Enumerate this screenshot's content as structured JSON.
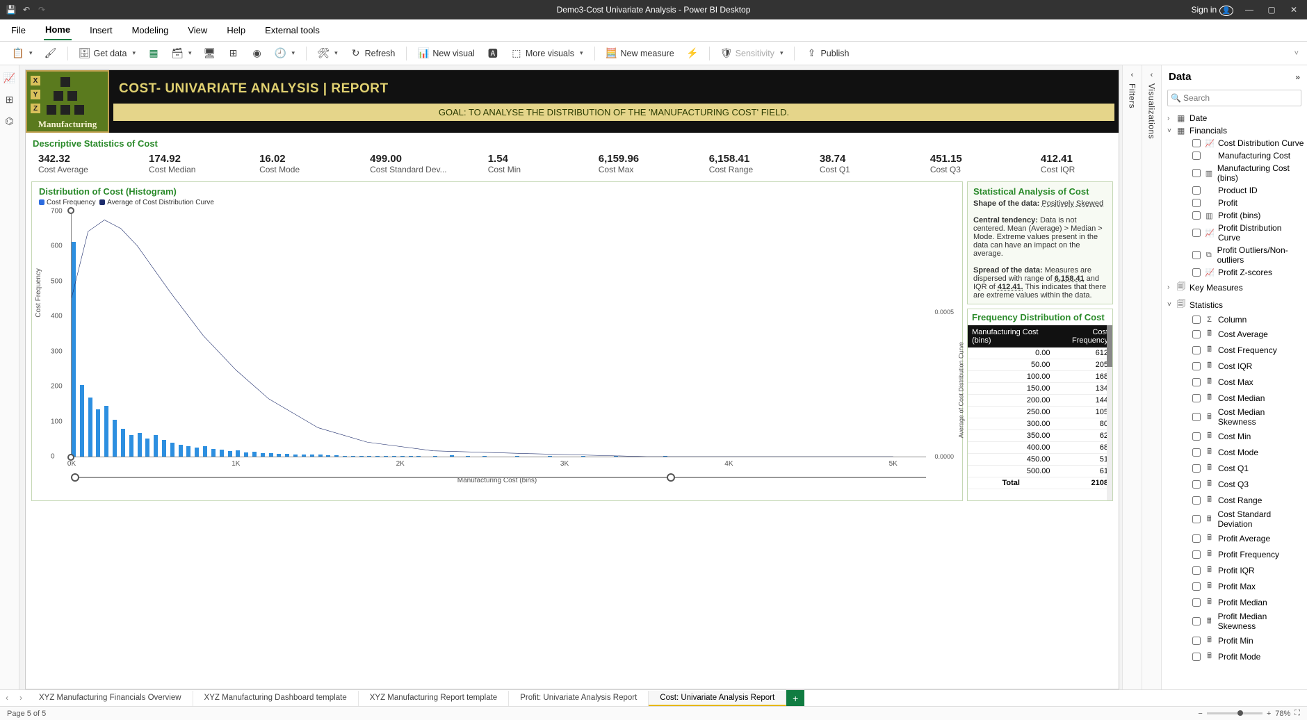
{
  "titlebar": {
    "title": "Demo3-Cost Univariate Analysis - Power BI Desktop",
    "sign_in": "Sign in"
  },
  "menubar": {
    "items": [
      "File",
      "Home",
      "Insert",
      "Modeling",
      "View",
      "Help",
      "External tools"
    ],
    "active": "Home"
  },
  "ribbon": {
    "get_data": "Get data",
    "refresh": "Refresh",
    "new_visual": "New visual",
    "more_visuals": "More visuals",
    "new_measure": "New measure",
    "sensitivity": "Sensitivity",
    "publish": "Publish"
  },
  "data_panel": {
    "header": "Data",
    "search_placeholder": "Search",
    "groups": [
      {
        "name": "Date",
        "expanded": false,
        "icon": "table"
      },
      {
        "name": "Financials",
        "expanded": true,
        "icon": "table",
        "fields": [
          {
            "name": "Cost Distribution Curve",
            "icon": "chart"
          },
          {
            "name": "Manufacturing Cost",
            "icon": ""
          },
          {
            "name": "Manufacturing Cost (bins)",
            "icon": "bins"
          },
          {
            "name": "Product ID",
            "icon": ""
          },
          {
            "name": "Profit",
            "icon": ""
          },
          {
            "name": "Profit (bins)",
            "icon": "bins"
          },
          {
            "name": "Profit Distribution Curve",
            "icon": "chart"
          },
          {
            "name": "Profit Outliers/Non-outliers",
            "icon": "group"
          },
          {
            "name": "Profit Z-scores",
            "icon": "chart"
          }
        ]
      },
      {
        "name": "Key Measures",
        "expanded": false,
        "icon": "measure"
      },
      {
        "name": "Statistics",
        "expanded": true,
        "icon": "measure",
        "fields": [
          {
            "name": "Column",
            "icon": "sigma"
          },
          {
            "name": "Cost Average",
            "icon": "calc"
          },
          {
            "name": "Cost Frequency",
            "icon": "calc"
          },
          {
            "name": "Cost IQR",
            "icon": "calc"
          },
          {
            "name": "Cost Max",
            "icon": "calc"
          },
          {
            "name": "Cost Median",
            "icon": "calc"
          },
          {
            "name": "Cost Median Skewness",
            "icon": "calc"
          },
          {
            "name": "Cost Min",
            "icon": "calc"
          },
          {
            "name": "Cost Mode",
            "icon": "calc"
          },
          {
            "name": "Cost Q1",
            "icon": "calc"
          },
          {
            "name": "Cost Q3",
            "icon": "calc"
          },
          {
            "name": "Cost Range",
            "icon": "calc"
          },
          {
            "name": "Cost Standard Deviation",
            "icon": "calc"
          },
          {
            "name": "Profit Average",
            "icon": "calc"
          },
          {
            "name": "Profit Frequency",
            "icon": "calc"
          },
          {
            "name": "Profit IQR",
            "icon": "calc"
          },
          {
            "name": "Profit Max",
            "icon": "calc"
          },
          {
            "name": "Profit Median",
            "icon": "calc"
          },
          {
            "name": "Profit Median Skewness",
            "icon": "calc"
          },
          {
            "name": "Profit Min",
            "icon": "calc"
          },
          {
            "name": "Profit Mode",
            "icon": "calc"
          }
        ]
      }
    ]
  },
  "side_panels": {
    "filters": "Filters",
    "visualizations": "Visualizations"
  },
  "report": {
    "logo_text": "Manufacturing",
    "xyz": [
      "X",
      "Y",
      "Z"
    ],
    "title": "COST- UNIVARIATE ANALYSIS | REPORT",
    "goal": "GOAL: TO ANALYSE THE DISTRIBUTION OF THE 'MANUFACTURING COST' FIELD.",
    "stats_title": "Descriptive Statistics of Cost",
    "stats": [
      {
        "val": "342.32",
        "lbl": "Cost Average"
      },
      {
        "val": "174.92",
        "lbl": "Cost Median"
      },
      {
        "val": "16.02",
        "lbl": "Cost Mode"
      },
      {
        "val": "499.00",
        "lbl": "Cost Standard Dev..."
      },
      {
        "val": "1.54",
        "lbl": "Cost Min"
      },
      {
        "val": "6,159.96",
        "lbl": "Cost Max"
      },
      {
        "val": "6,158.41",
        "lbl": "Cost Range"
      },
      {
        "val": "38.74",
        "lbl": "Cost Q1"
      },
      {
        "val": "451.15",
        "lbl": "Cost Q3"
      },
      {
        "val": "412.41",
        "lbl": "Cost IQR"
      }
    ],
    "histo": {
      "title": "Distribution of Cost (Histogram)",
      "legend_a": "Cost Frequency",
      "legend_b": "Average of Cost Distribution Curve",
      "ylabel": "Cost Frequency",
      "y2label": "Average of Cost Distribution Curve",
      "xlabel": "Manufacturing Cost (bins)"
    },
    "analysis": {
      "title": "Statistical Analysis of Cost",
      "shape_label": "Shape of the data:",
      "shape_value": "Positively Skewed",
      "central_label": "Central tendency:",
      "central_text": "Data is not centered. Mean (Average) > Median > Mode. Extreme values present in the data can have an impact on the average.",
      "spread_label": "Spread of the data:",
      "spread_text_a": "Measures are dispersed with range of ",
      "spread_range": "6,158.41",
      "spread_text_b": " and IQR of ",
      "spread_iqr": "412.41.",
      "spread_text_c": " This indicates that there are extreme values within the data."
    },
    "freq": {
      "title": "Frequency Distribution of Cost",
      "col_a": "Manufacturing Cost (bins)",
      "col_b": "Cost Frequency",
      "rows": [
        {
          "bin": "0.00",
          "freq": "612"
        },
        {
          "bin": "50.00",
          "freq": "205"
        },
        {
          "bin": "100.00",
          "freq": "168"
        },
        {
          "bin": "150.00",
          "freq": "134"
        },
        {
          "bin": "200.00",
          "freq": "144"
        },
        {
          "bin": "250.00",
          "freq": "105"
        },
        {
          "bin": "300.00",
          "freq": "80"
        },
        {
          "bin": "350.00",
          "freq": "62"
        },
        {
          "bin": "400.00",
          "freq": "68"
        },
        {
          "bin": "450.00",
          "freq": "51"
        },
        {
          "bin": "500.00",
          "freq": "61"
        }
      ],
      "total_label": "Total",
      "total_value": "2108"
    }
  },
  "tabs": {
    "pages": [
      "XYZ Manufacturing Financials Overview",
      "XYZ Manufacturing Dashboard template",
      "XYZ Manufacturing Report template",
      "Profit: Univariate Analysis Report",
      "Cost: Univariate Analysis Report"
    ],
    "active_index": 4
  },
  "status": {
    "page_info": "Page 5 of 5",
    "zoom": "78%"
  },
  "chart_data": {
    "type": "bar+line",
    "title": "Distribution of Cost (Histogram)",
    "xlabel": "Manufacturing Cost (bins)",
    "ylabel": "Cost Frequency",
    "y2label": "Average of Cost Distribution Curve",
    "x_ticks": [
      "0K",
      "1K",
      "2K",
      "3K",
      "4K",
      "5K"
    ],
    "y_ticks": [
      0,
      100,
      200,
      300,
      400,
      500,
      600,
      700
    ],
    "y2_ticks": [
      0.0,
      0.0005
    ],
    "ylim": [
      0,
      700
    ],
    "xlim": [
      0,
      5200
    ],
    "series": [
      {
        "name": "Cost Frequency",
        "type": "bar",
        "bin_width": 50,
        "values": [
          {
            "x": 0,
            "y": 612
          },
          {
            "x": 50,
            "y": 205
          },
          {
            "x": 100,
            "y": 168
          },
          {
            "x": 150,
            "y": 134
          },
          {
            "x": 200,
            "y": 144
          },
          {
            "x": 250,
            "y": 105
          },
          {
            "x": 300,
            "y": 80
          },
          {
            "x": 350,
            "y": 62
          },
          {
            "x": 400,
            "y": 68
          },
          {
            "x": 450,
            "y": 51
          },
          {
            "x": 500,
            "y": 61
          },
          {
            "x": 550,
            "y": 48
          },
          {
            "x": 600,
            "y": 40
          },
          {
            "x": 650,
            "y": 34
          },
          {
            "x": 700,
            "y": 30
          },
          {
            "x": 750,
            "y": 25
          },
          {
            "x": 800,
            "y": 30
          },
          {
            "x": 850,
            "y": 22
          },
          {
            "x": 900,
            "y": 20
          },
          {
            "x": 950,
            "y": 16
          },
          {
            "x": 1000,
            "y": 18
          },
          {
            "x": 1050,
            "y": 12
          },
          {
            "x": 1100,
            "y": 14
          },
          {
            "x": 1150,
            "y": 10
          },
          {
            "x": 1200,
            "y": 10
          },
          {
            "x": 1250,
            "y": 8
          },
          {
            "x": 1300,
            "y": 8
          },
          {
            "x": 1350,
            "y": 6
          },
          {
            "x": 1400,
            "y": 6
          },
          {
            "x": 1450,
            "y": 5
          },
          {
            "x": 1500,
            "y": 6
          },
          {
            "x": 1550,
            "y": 4
          },
          {
            "x": 1600,
            "y": 4
          },
          {
            "x": 1650,
            "y": 3
          },
          {
            "x": 1700,
            "y": 3
          },
          {
            "x": 1750,
            "y": 3
          },
          {
            "x": 1800,
            "y": 2
          },
          {
            "x": 1850,
            "y": 2
          },
          {
            "x": 1900,
            "y": 2
          },
          {
            "x": 1950,
            "y": 2
          },
          {
            "x": 2000,
            "y": 3
          },
          {
            "x": 2050,
            "y": 2
          },
          {
            "x": 2100,
            "y": 2
          },
          {
            "x": 2200,
            "y": 2
          },
          {
            "x": 2300,
            "y": 4
          },
          {
            "x": 2400,
            "y": 2
          },
          {
            "x": 2500,
            "y": 2
          },
          {
            "x": 2700,
            "y": 2
          },
          {
            "x": 2900,
            "y": 2
          },
          {
            "x": 3100,
            "y": 2
          },
          {
            "x": 3300,
            "y": 2
          },
          {
            "x": 3600,
            "y": 2
          }
        ]
      },
      {
        "name": "Average of Cost Distribution Curve",
        "type": "line",
        "axis": "y2",
        "values": [
          {
            "x": 0,
            "y": 0.00055
          },
          {
            "x": 100,
            "y": 0.00078
          },
          {
            "x": 200,
            "y": 0.00082
          },
          {
            "x": 300,
            "y": 0.00079
          },
          {
            "x": 400,
            "y": 0.00073
          },
          {
            "x": 500,
            "y": 0.00065
          },
          {
            "x": 600,
            "y": 0.00057
          },
          {
            "x": 800,
            "y": 0.00042
          },
          {
            "x": 1000,
            "y": 0.0003
          },
          {
            "x": 1200,
            "y": 0.0002
          },
          {
            "x": 1500,
            "y": 0.0001
          },
          {
            "x": 1800,
            "y": 5e-05
          },
          {
            "x": 2200,
            "y": 2e-05
          },
          {
            "x": 2800,
            "y": 1e-05
          },
          {
            "x": 3500,
            "y": 0.0
          },
          {
            "x": 5000,
            "y": 0.0
          }
        ]
      }
    ]
  }
}
